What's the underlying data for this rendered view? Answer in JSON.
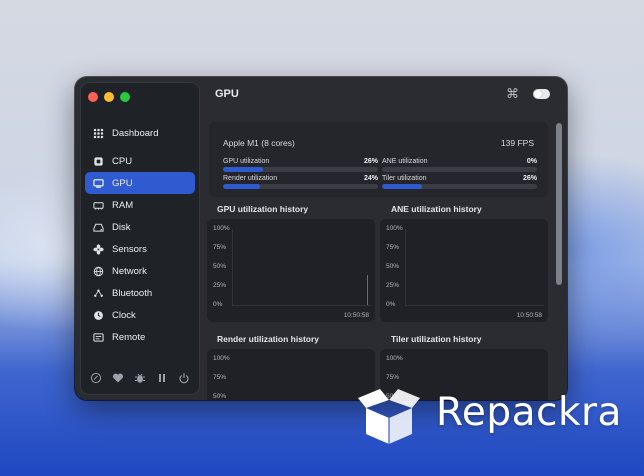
{
  "window": {
    "title": "GPU",
    "shortcut_glyph": "⌘"
  },
  "sidebar": {
    "items": [
      {
        "label": "Dashboard",
        "icon": "grid-icon"
      },
      {
        "label": "CPU",
        "icon": "chip-icon"
      },
      {
        "label": "GPU",
        "icon": "monitor-icon",
        "active": true
      },
      {
        "label": "RAM",
        "icon": "memory-icon"
      },
      {
        "label": "Disk",
        "icon": "disk-icon"
      },
      {
        "label": "Sensors",
        "icon": "fan-icon"
      },
      {
        "label": "Network",
        "icon": "globe-icon"
      },
      {
        "label": "Bluetooth",
        "icon": "bluetooth-icon"
      },
      {
        "label": "Clock",
        "icon": "clock-icon"
      },
      {
        "label": "Remote",
        "icon": "remote-icon"
      }
    ],
    "bottom_icons": [
      "settings-icon",
      "heart-icon",
      "bug-icon",
      "pause-icon",
      "power-icon"
    ]
  },
  "gpu": {
    "chip": "Apple M1 (8 cores)",
    "fps": "139 FPS",
    "metrics": [
      {
        "label": "GPU utilization",
        "value": "26%",
        "fraction": 0.26
      },
      {
        "label": "ANE utilization",
        "value": "0%",
        "fraction": 0.0
      },
      {
        "label": "Render utilization",
        "value": "24%",
        "fraction": 0.24
      },
      {
        "label": "Tiler utilization",
        "value": "26%",
        "fraction": 0.26
      }
    ]
  },
  "history": {
    "y_ticks": [
      "100%",
      "75%",
      "50%",
      "25%",
      "0%"
    ],
    "partial_ticks": [
      "100%",
      "75%",
      "50%"
    ],
    "time_label": "10:50:58",
    "charts": [
      {
        "title": "GPU utilization history",
        "spike_fraction": 0.26
      },
      {
        "title": "ANE utilization history",
        "spike_fraction": 0.0
      },
      {
        "title": "Render utilization history"
      },
      {
        "title": "Tiler utilization history"
      }
    ]
  },
  "watermark": {
    "text": "Repackra"
  },
  "colors": {
    "accent": "#2f5ad0",
    "window_bg": "#2a2c31",
    "sidebar_bg": "#1f2227"
  }
}
